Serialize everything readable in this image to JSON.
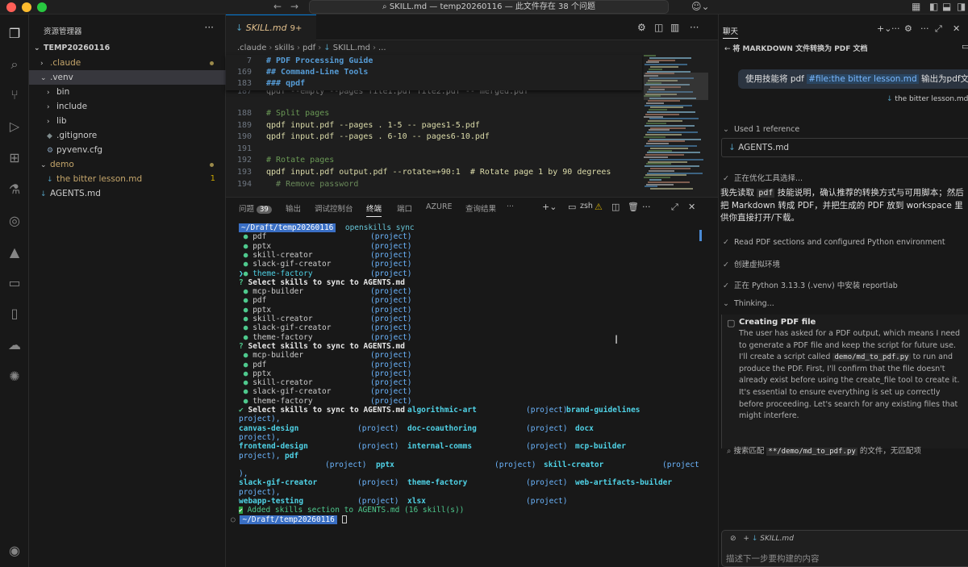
{
  "titlebar": {
    "back_icon": "arrow-left-icon",
    "forward_icon": "arrow-right-icon",
    "search_icon": "search-icon",
    "command_center": "SKILL.md — temp20260116 — 此文件存在 38 个问题"
  },
  "activity": [
    "files-icon",
    "search-icon",
    "source-control-icon",
    "run-debug-icon",
    "extensions-icon",
    "testing-icon",
    "github-icon",
    "azure-icon",
    "remote-explorer-icon",
    "book-icon",
    "cloud-icon",
    "openai-icon",
    "account-icon"
  ],
  "sidebar": {
    "title": "资源管理器",
    "more": "···",
    "root": "TEMP20260116",
    "items": [
      {
        "label": ".claude",
        "chev": "›",
        "indent": 1
      },
      {
        "label": ".venv",
        "chev": "⌄",
        "indent": 1
      },
      {
        "label": "bin",
        "chev": "›",
        "indent": 2
      },
      {
        "label": "include",
        "chev": "›",
        "indent": 2
      },
      {
        "label": "lib",
        "chev": "›",
        "indent": 2
      },
      {
        "label": ".gitignore",
        "chev": "",
        "indent": 2
      },
      {
        "label": "pyvenv.cfg",
        "chev": "",
        "indent": 2
      },
      {
        "label": "demo",
        "chev": "⌄",
        "indent": 1
      },
      {
        "label": "the bitter lesson.md",
        "chev": "",
        "indent": 2,
        "badge": "1"
      },
      {
        "label": "AGENTS.md",
        "chev": "",
        "indent": 1
      }
    ]
  },
  "editor": {
    "tab_label": "SKILL.md",
    "tab_problems": "9+",
    "breadcrumb": [
      ".claude",
      "skills",
      "pdf",
      "SKILL.md",
      "..."
    ],
    "sticky": [
      {
        "ln": "7",
        "text": "# PDF Processing Guide"
      },
      {
        "ln": "169",
        "text": "## Command-Line Tools"
      },
      {
        "ln": "183",
        "text": "### qpdf"
      }
    ],
    "lines": [
      {
        "ln": "187",
        "text": ""
      },
      {
        "ln": "188",
        "text": "# Split pages"
      },
      {
        "ln": "189",
        "text": "qpdf input.pdf --pages . 1-5 -- pages1-5.pdf"
      },
      {
        "ln": "190",
        "text": "qpdf input.pdf --pages . 6-10 -- pages6-10.pdf"
      },
      {
        "ln": "191",
        "text": ""
      },
      {
        "ln": "192",
        "text": "# Rotate pages"
      },
      {
        "ln": "193",
        "text": "qpdf input.pdf output.pdf --rotate=+90:1  # Rotate page 1 by 90 degrees"
      },
      {
        "ln": "194",
        "text": ""
      }
    ]
  },
  "panel": {
    "tabs": [
      {
        "label": "问题",
        "badge": "39"
      },
      {
        "label": "输出"
      },
      {
        "label": "调试控制台"
      },
      {
        "label": "终端",
        "active": true
      },
      {
        "label": "端口"
      },
      {
        "label": "AZURE"
      },
      {
        "label": "查询结果"
      },
      {
        "label": "···"
      }
    ],
    "shell": "zsh",
    "prompt": "~/Draft/temp20260116",
    "command": "openskills sync",
    "tag": "(project)",
    "list1": [
      "pdf",
      "pptx",
      "skill-creator",
      "slack-gif-creator",
      "theme-factory"
    ],
    "question": "Select skills to sync to AGENTS.md",
    "list2": [
      "mcp-builder",
      "pdf",
      "pptx",
      "skill-creator",
      "slack-gif-creator",
      "theme-factory"
    ],
    "list3": [
      "mcp-builder",
      "pdf",
      "pptx",
      "skill-creator",
      "slack-gif-creator",
      "theme-factory"
    ],
    "summary_lines": [
      "algorithmic-art",
      "brand-guidelines",
      "canvas-design",
      "doc-coauthoring",
      "docx",
      "frontend-design",
      "internal-comms",
      "mcp-builder",
      "pdf",
      "pptx",
      "skill-creator",
      "slack-gif-creator",
      "theme-factory",
      "web-artifacts-builder",
      "webapp-testing",
      "xlsx"
    ],
    "result": "Added skills section to AGENTS.md (16 skill(s))"
  },
  "chat": {
    "title": "聊天",
    "subtitle": "将 MARKDOWN 文件转换为 PDF 文档",
    "user_prefix": "使用技能将 pdf",
    "user_ref": "#file:the bitter lesson.md",
    "user_suffix": "输出为pdf文档",
    "attachment": "the bitter lesson.md",
    "used_ref": "Used 1 reference",
    "ref_file": "AGENTS.md",
    "optimizing": "正在优化工具选择...",
    "response_pre": "我先读取",
    "response_chip": "pdf",
    "response_post": "技能说明，确认推荐的转换方式与可用脚本；然后把 Markdown 转成 PDF，并把生成的 PDF 放到 workspace 里供你直接打开/下载。",
    "step1": "Read PDF sections and configured Python environment",
    "step2": "创建虚拟环境",
    "step3": "正在 Python 3.13.3 (.venv) 中安装 reportlab",
    "thinking": "Thinking...",
    "think_title": "Creating PDF file",
    "think_a": "The user has asked for a PDF output, which means I need to generate a PDF file and keep the script for future use. I'll create a script called",
    "think_chip": "demo/md_to_pdf.py",
    "think_b": "to run and produce the PDF. First, I'll confirm that the file doesn't already exist before using the create_file tool to create it. It's essential to ensure everything is set up correctly before proceeding. Let's search for any existing files that might interfere.",
    "search_pre": "搜索匹配",
    "search_chip": "**/demo/md_to_pdf.py",
    "search_post": "的文件，无匹配项",
    "input_file": "SKILL.md",
    "input_placeholder": "描述下一步要构建的内容"
  },
  "colors": {
    "accent": "#0078d4",
    "prompt_bg": "#3a6fc4",
    "skill_green": "#4ec98d"
  }
}
